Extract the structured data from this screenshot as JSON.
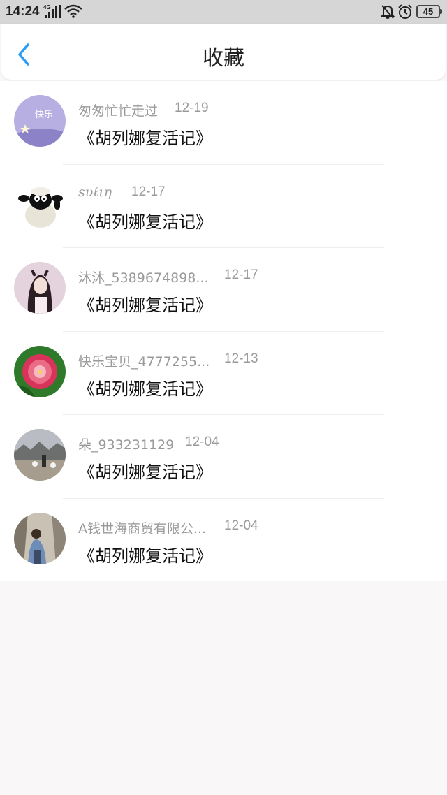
{
  "status_bar": {
    "time": "14:24",
    "network": "4G",
    "battery": "45"
  },
  "header": {
    "title": "收藏",
    "back_icon": "chevron-left-icon",
    "accent_color": "#2a9df4"
  },
  "favorites": [
    {
      "user": "匆匆忙忙走过",
      "date": "12-19",
      "title": "《胡列娜复活记》"
    },
    {
      "user": "ѕυℓιη",
      "date": "12-17",
      "title": "《胡列娜复活记》"
    },
    {
      "user": "沐沐_5389674898...",
      "date": "12-17",
      "title": "《胡列娜复活记》"
    },
    {
      "user": "快乐宝贝_4777255...",
      "date": "12-13",
      "title": "《胡列娜复活记》"
    },
    {
      "user": "朵_933231129",
      "date": "12-04",
      "title": "《胡列娜复活记》"
    },
    {
      "user": "A钱世海商贸有限公...",
      "date": "12-04",
      "title": "《胡列娜复活记》"
    }
  ]
}
